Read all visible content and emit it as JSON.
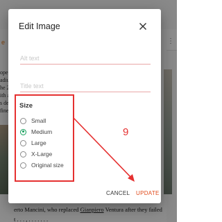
{
  "background": {
    "left_text_lines": [
      "ope,",
      "adiu",
      "he 2",
      "ith a",
      "s de",
      "fine"
    ],
    "bottom_text_parts": [
      "erto Mancini, who replaced ",
      "Gianpiero",
      " Ventura after they failed"
    ],
    "bottom_text_line2": "t . . . , . . . . . . ."
  },
  "dialog": {
    "title": "Edit Image",
    "alt_text_placeholder": "Alt text",
    "title_text_placeholder": "Title text",
    "size_label": "Size",
    "size_options": [
      {
        "label": "Small",
        "checked": false
      },
      {
        "label": "Medium",
        "checked": true
      },
      {
        "label": "Large",
        "checked": false
      },
      {
        "label": "X-Large",
        "checked": false
      },
      {
        "label": "Original size",
        "checked": false
      }
    ],
    "cancel_label": "CANCEL",
    "update_label": "UPDATE"
  },
  "annotation": {
    "step_number": "9",
    "color": "#e53030"
  },
  "colors": {
    "accent_green": "#0f9d58",
    "update_orange": "#e04a1a",
    "annotation_red": "#e53030"
  }
}
